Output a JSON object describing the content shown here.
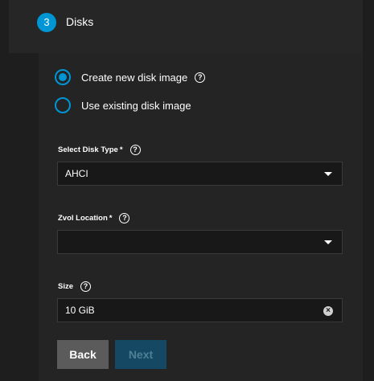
{
  "step": {
    "number": "3",
    "title": "Disks"
  },
  "disk_image_options": [
    {
      "label": "Create new disk image",
      "checked": true,
      "has_help": true
    },
    {
      "label": "Use existing disk image",
      "checked": false,
      "has_help": false
    }
  ],
  "fields": {
    "disk_type": {
      "label": "Select Disk Type",
      "required_mark": "*",
      "value": "AHCI"
    },
    "zvol_location": {
      "label": "Zvol Location",
      "required_mark": "*",
      "value": ""
    },
    "size": {
      "label": "Size",
      "value": "10 GiB"
    }
  },
  "help_glyph": "?",
  "clear_glyph": "×",
  "buttons": {
    "back": "Back",
    "next": "Next"
  },
  "colors": {
    "accent": "#0095d5",
    "background": "#1e1e1e",
    "next_disabled": "#154963",
    "back": "#5b5b5b"
  }
}
